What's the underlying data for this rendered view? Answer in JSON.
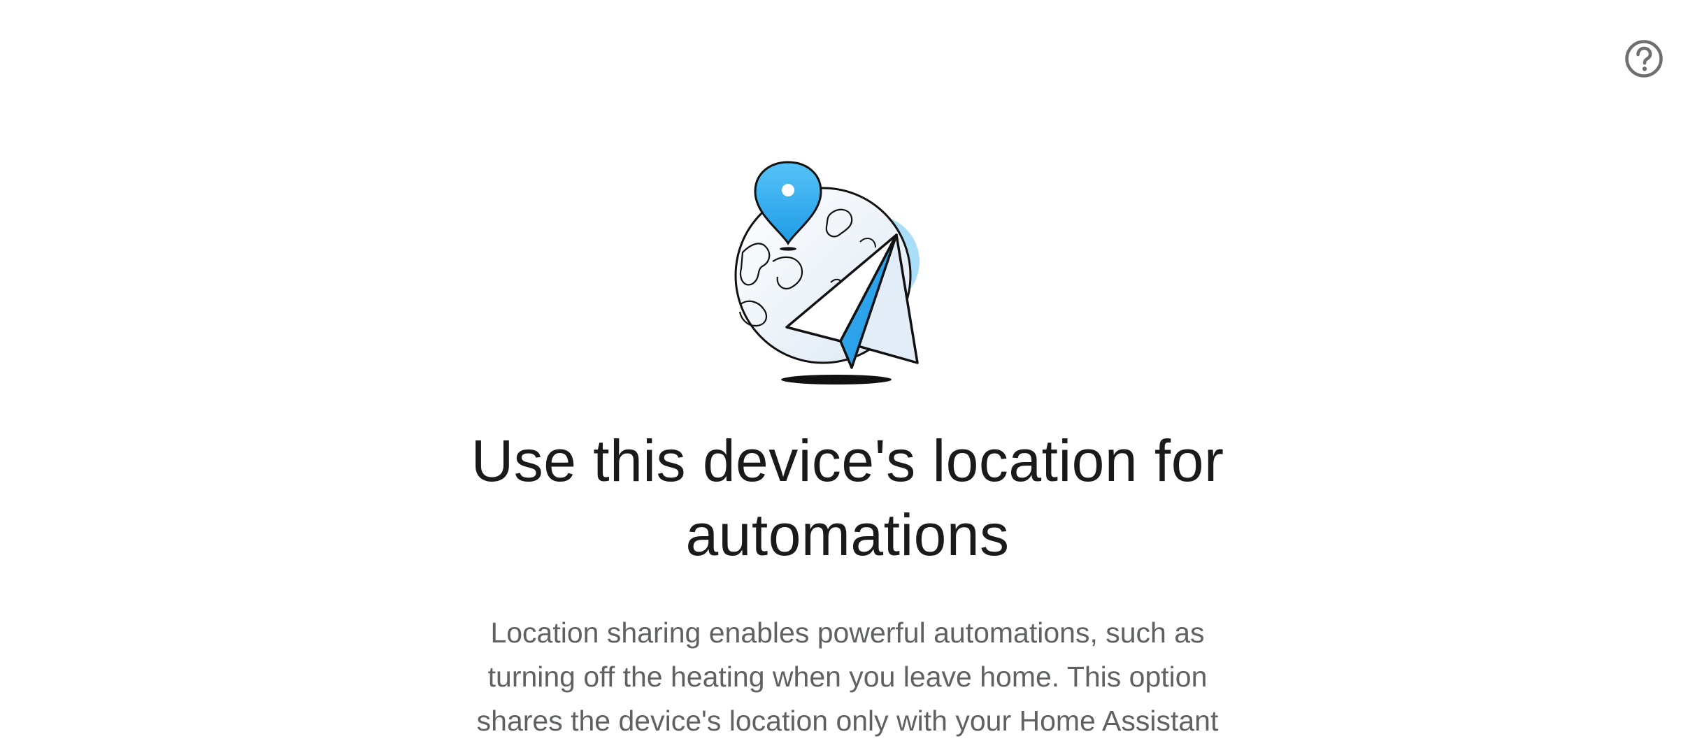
{
  "help": {
    "icon": "help-circle-icon",
    "label": "Help"
  },
  "illustration": {
    "name": "globe-location-paper-plane-illustration",
    "colors": {
      "accent_blue": "#2FA9EE",
      "light_blue": "#A9DDF8",
      "outline": "#111111",
      "globe_fill": "#F2F6FA"
    }
  },
  "content": {
    "title": "Use this device's location for automations",
    "description": "Location sharing enables powerful automations, such as turning off the heating when you leave home. This option shares the device's location only with your Home Assistant system."
  }
}
